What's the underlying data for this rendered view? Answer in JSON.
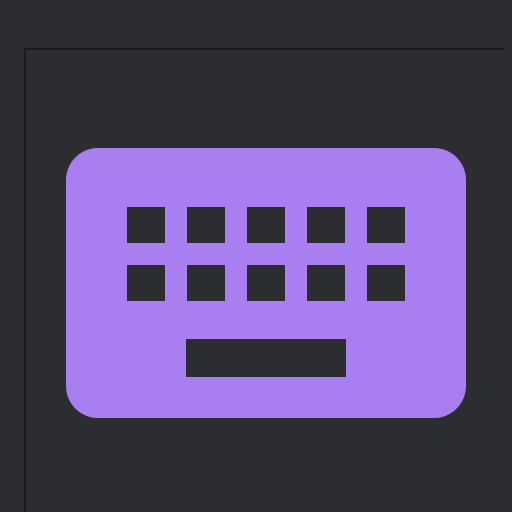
{
  "icon": {
    "name": "keyboard-icon",
    "key_rows": 2,
    "keys_per_row": 5,
    "has_spacebar": true
  },
  "colors": {
    "background": "#2b2d30",
    "panel_border": "#1a1b1d",
    "icon_fill": "#a87ef0",
    "key_cutout": "#2b2d30"
  }
}
